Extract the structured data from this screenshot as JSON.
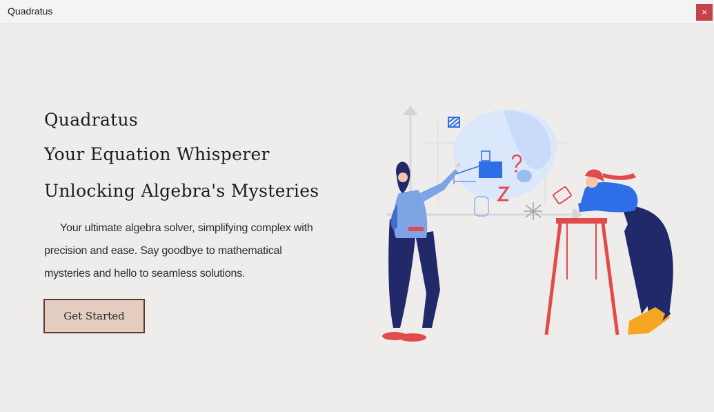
{
  "window": {
    "title": "Quadratus",
    "close_glyph": "×"
  },
  "hero": {
    "line1": "Quadratus",
    "line2": "Your Equation Whisperer",
    "line3": "Unlocking Algebra's Mysteries",
    "description": "Your ultimate algebra solver, simplifying complex with precision and ease. Say goodbye to mathematical mysteries and hello to seamless solutions.",
    "button_label": "Get Started"
  },
  "illustration": {
    "name": "two-people-solving-math-illustration",
    "letter": "Z",
    "colors": {
      "accent_blue": "#2e6ee6",
      "navy": "#22296a",
      "red": "#e24b4b",
      "yellow": "#f5a623",
      "skin": "#f6c6ab"
    }
  },
  "colors": {
    "background": "#efedeb",
    "button_fill": "#e2cdc0",
    "button_border": "#5b3a29",
    "close_button": "#c7434b"
  }
}
